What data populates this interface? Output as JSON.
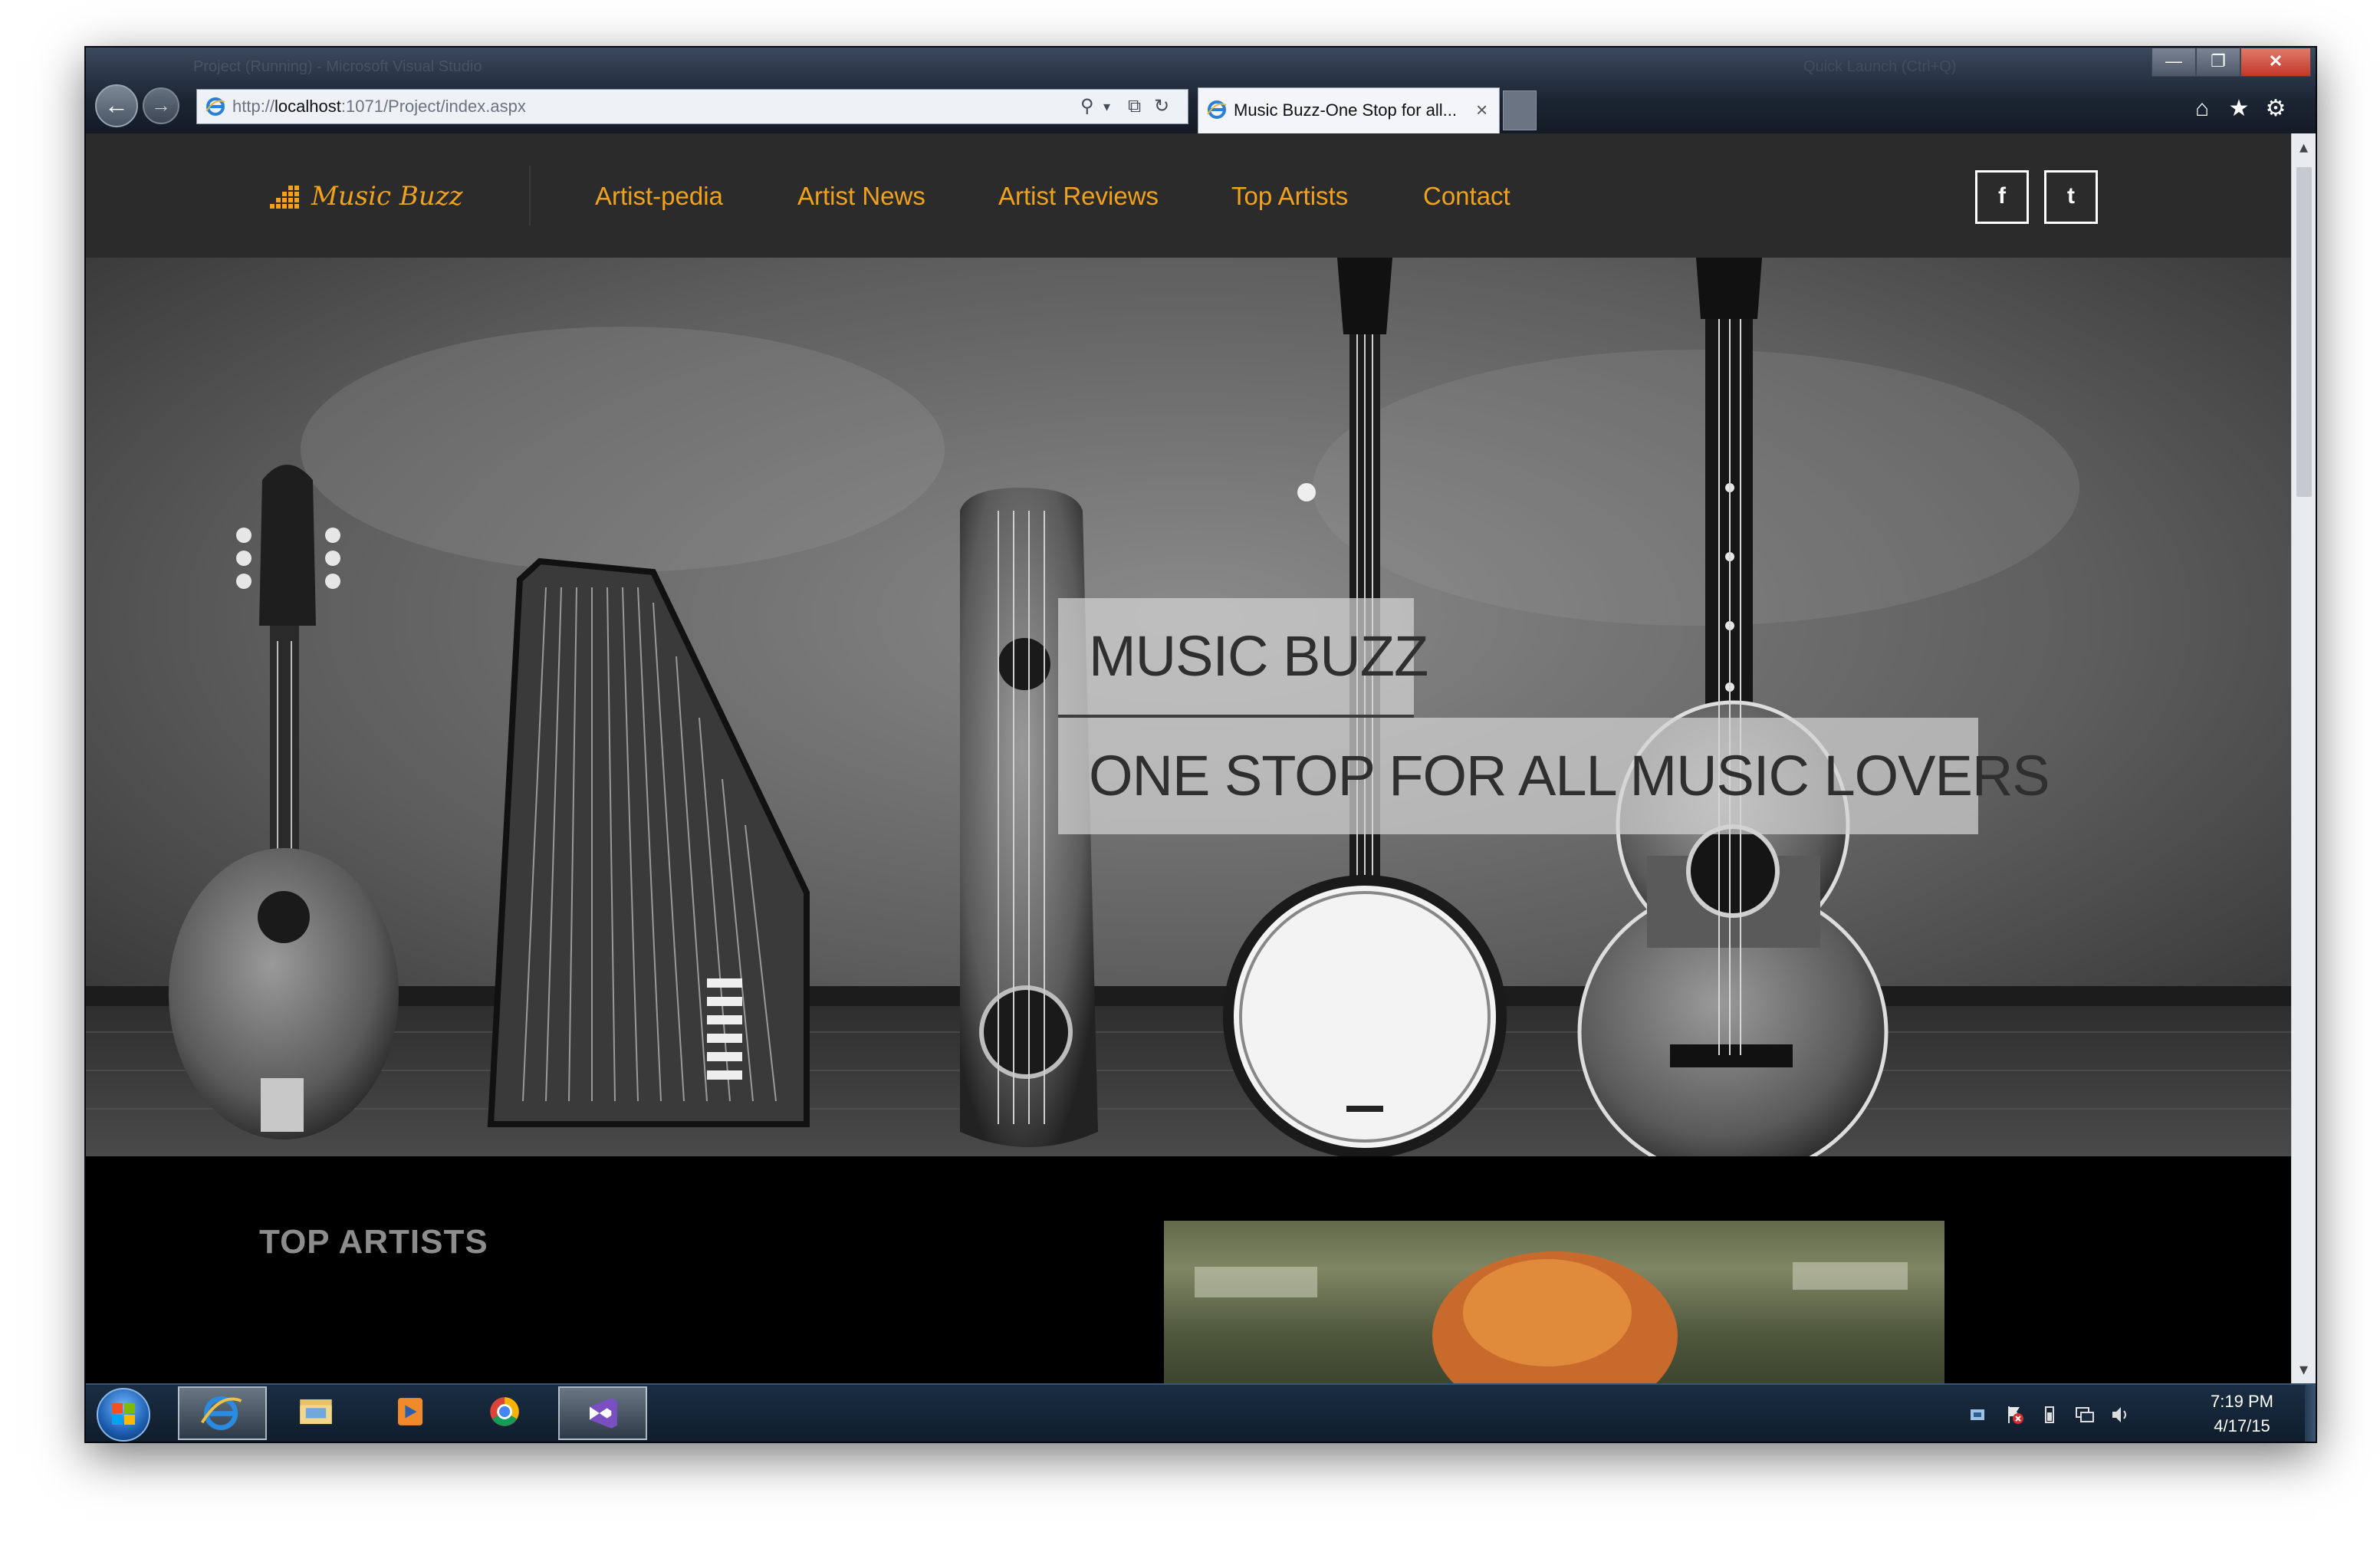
{
  "browser": {
    "window_title": "Project (Running) - Microsoft Visual Studio",
    "search_hint": "Quick Launch (Ctrl+Q)",
    "url_prefix": "http://",
    "url_host": "localhost",
    "url_rest": ":1071/Project/index.aspx",
    "tab_title": "Music Buzz-One Stop for all...",
    "tab_close": "×",
    "controls": {
      "search": "⚲",
      "dropdown": "▾",
      "compat": "⧉",
      "refresh": "↻",
      "back": "←",
      "forward": "→",
      "minimize": "—",
      "maximize": "❐",
      "close": "✕",
      "home": "⌂",
      "favorites": "★",
      "tools": "⚙"
    }
  },
  "site": {
    "logo_text": "Music Buzz",
    "nav": [
      {
        "label": "Artist-pedia"
      },
      {
        "label": "Artist News"
      },
      {
        "label": "Artist Reviews"
      },
      {
        "label": "Top Artists"
      },
      {
        "label": "Contact"
      }
    ],
    "social": [
      {
        "label": "f",
        "icon": "facebook-icon"
      },
      {
        "label": "t",
        "icon": "twitter-icon"
      }
    ],
    "accent_color": "#f0a21c",
    "header_bg": "#2b2b2c"
  },
  "hero": {
    "title": "MUSIC BUZZ",
    "subtitle": "ONE STOP FOR ALL MUSIC LOVERS",
    "image_subject": "vintage string instruments against a wall"
  },
  "section": {
    "title": "TOP ARTISTS"
  },
  "scrollbar": {
    "up": "▴",
    "down": "▾"
  },
  "taskbar": {
    "apps": [
      {
        "name": "Internet Explorer",
        "icon": "internet-explorer-icon",
        "active": true
      },
      {
        "name": "Windows Explorer",
        "icon": "folder-icon",
        "active": false
      },
      {
        "name": "Windows Media Player",
        "icon": "media-player-icon",
        "active": false
      },
      {
        "name": "Google Chrome",
        "icon": "chrome-icon",
        "active": false
      },
      {
        "name": "Visual Studio",
        "icon": "visual-studio-icon",
        "active": true
      }
    ],
    "time": "7:19 PM",
    "date": "4/17/15"
  }
}
